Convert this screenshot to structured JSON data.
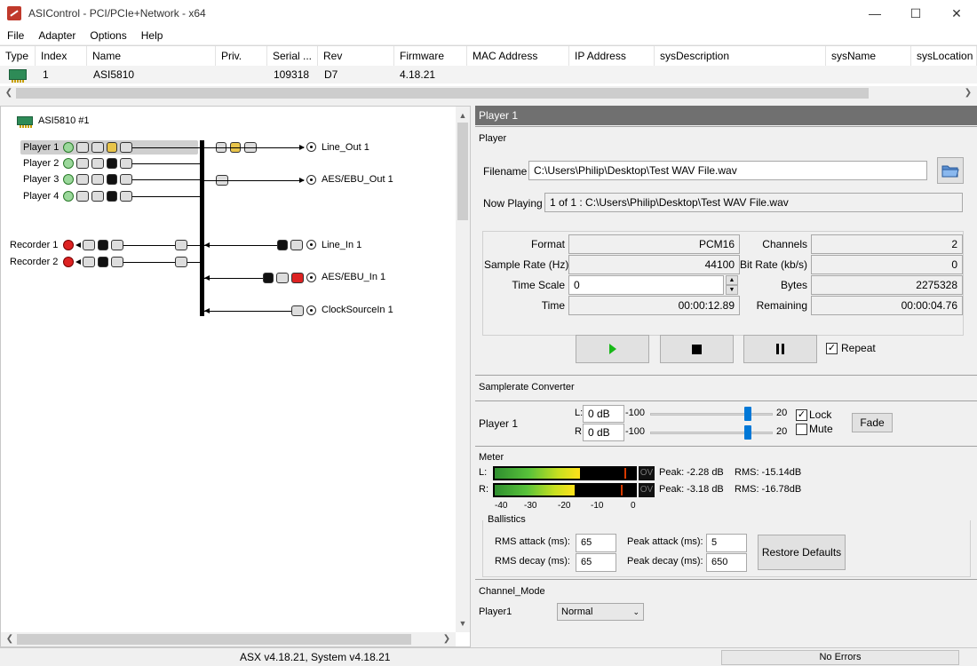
{
  "window": {
    "title": "ASIControl - PCI/PCIe+Network - x64",
    "minimize": "—",
    "maximize": "☐",
    "close": "✕"
  },
  "menu": [
    "File",
    "Adapter",
    "Options",
    "Help"
  ],
  "adapter_table": {
    "columns": [
      "Type",
      "Index",
      "Name",
      "Priv.",
      "Serial ...",
      "Rev",
      "Firmware",
      "MAC Address",
      "IP Address",
      "sysDescription",
      "sysName",
      "sysLocation"
    ],
    "row": {
      "type_icon": "sound-card-icon",
      "index": "1",
      "name": "ASI5810",
      "priv": "",
      "serial": "109318",
      "rev": "D7",
      "firmware": "4.18.21",
      "mac": "",
      "ip": "",
      "sysdesc": "",
      "sysname": "",
      "syslocation": ""
    }
  },
  "tree": {
    "root": "ASI5810 #1",
    "players": [
      "Player  1",
      "Player  2",
      "Player  3",
      "Player  4"
    ],
    "recorders": [
      "Recorder  1",
      "Recorder  2"
    ],
    "outputs": [
      "Line_Out  1",
      "AES/EBU_Out  1"
    ],
    "inputs": [
      "Line_In  1",
      "AES/EBU_In  1",
      "ClockSourceIn  1"
    ]
  },
  "player_panel": {
    "header": "Player  1",
    "group_title": "Player",
    "filename_label": "Filename",
    "filename": "C:\\Users\\Philip\\Desktop\\Test WAV File.wav",
    "now_playing_label": "Now Playing",
    "now_playing": "1 of 1 : C:\\Users\\Philip\\Desktop\\Test WAV File.wav",
    "format_label": "Format",
    "format": "PCM16",
    "channels_label": "Channels",
    "channels": "2",
    "sample_rate_label": "Sample Rate (Hz)",
    "sample_rate": "44100",
    "bit_rate_label": "Bit Rate (kb/s)",
    "bit_rate": "0",
    "time_scale_label": "Time Scale",
    "time_scale": "0",
    "bytes_label": "Bytes",
    "bytes": "2275328",
    "time_label": "Time",
    "time": "00:00:12.89",
    "remaining_label": "Remaining",
    "remaining": "00:00:04.76",
    "repeat_label": "Repeat",
    "repeat_checked": true
  },
  "src": {
    "group_title": "Samplerate Converter",
    "player_label": "Player  1",
    "l_label": "L:",
    "l_value": "0 dB",
    "r_label": "R:",
    "r_value": "0 dB",
    "min": "-100",
    "max": "20",
    "lock_label": "Lock",
    "lock_checked": true,
    "mute_label": "Mute",
    "mute_checked": false,
    "fade_label": "Fade"
  },
  "meter": {
    "group_title": "Meter",
    "l_label": "L:",
    "r_label": "R:",
    "ov": "OV",
    "l_peak": "Peak: -2.28 dB",
    "l_rms": "RMS: -15.14dB",
    "r_peak": "Peak: -3.18 dB",
    "r_rms": "RMS: -16.78dB",
    "scale": [
      "-40",
      "-30",
      "-20",
      "-10",
      "0"
    ],
    "ballistics_title": "Ballistics",
    "rms_attack_label": "RMS attack (ms):",
    "rms_attack": "65",
    "rms_decay_label": "RMS decay (ms):",
    "rms_decay": "65",
    "peak_attack_label": "Peak attack (ms):",
    "peak_attack": "5",
    "peak_decay_label": "Peak decay (ms):",
    "peak_decay": "650",
    "restore_label": "Restore Defaults"
  },
  "channel_mode": {
    "group_title": "Channel_Mode",
    "player_label": "Player1",
    "value": "Normal"
  },
  "status": {
    "version": "ASX v4.18.21, System v4.18.21",
    "errors": "No Errors"
  }
}
